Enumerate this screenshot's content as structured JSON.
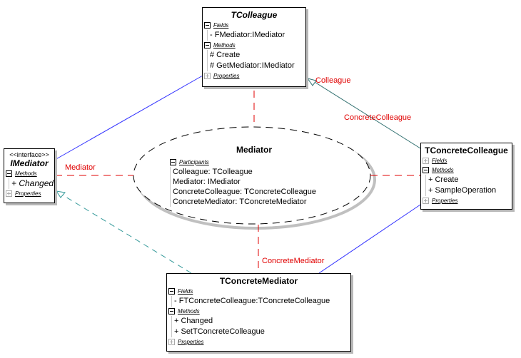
{
  "colors": {
    "association": "#3333ff",
    "realization": "#339999",
    "generalization": "#2f6f6f",
    "pattern_link": "#e00000",
    "label": "#e00000"
  },
  "classes": {
    "tcolleague": {
      "name": "TColleague",
      "abstract": true,
      "sections": {
        "fields": {
          "label": "Fields",
          "expanded": true,
          "items": [
            "- FMediator:IMediator"
          ]
        },
        "methods": {
          "label": "Methods",
          "expanded": true,
          "items": [
            "# Create",
            "# GetMediator:IMediator"
          ]
        },
        "properties": {
          "label": "Properties",
          "expanded": false
        }
      }
    },
    "imediator": {
      "stereotype": "<<interface>>",
      "name": "IMediator",
      "sections": {
        "methods": {
          "label": "Methods",
          "expanded": true,
          "items": [
            "+ Changed"
          ]
        },
        "properties": {
          "label": "Properties",
          "expanded": false
        }
      }
    },
    "tconcretecolleague": {
      "name": "TConcreteColleague",
      "sections": {
        "fields": {
          "label": "Fields",
          "expanded": false
        },
        "methods": {
          "label": "Methods",
          "expanded": true,
          "items": [
            "+ Create",
            "+ SampleOperation"
          ]
        },
        "properties": {
          "label": "Properties",
          "expanded": false
        }
      }
    },
    "tconcretemediator": {
      "name": "TConcreteMediator",
      "sections": {
        "fields": {
          "label": "Fields",
          "expanded": true,
          "items": [
            "- FTConcreteColleague:TConcreteColleague"
          ]
        },
        "methods": {
          "label": "Methods",
          "expanded": true,
          "items": [
            "+ Changed",
            "+ SetTConcreteColleague"
          ]
        },
        "properties": {
          "label": "Properties",
          "expanded": false
        }
      }
    }
  },
  "pattern": {
    "name": "Mediator",
    "section_label": "Participants",
    "participants": [
      "Colleague: TColleague",
      "Mediator: IMediator",
      "ConcreteColleague: TConcreteColleague",
      "ConcreteMediator: TConcreteMediator"
    ]
  },
  "link_labels": {
    "mediator": "Mediator",
    "colleague": "Colleague",
    "concrete_colleague": "ConcreteColleague",
    "concrete_mediator": "ConcreteMediator"
  }
}
